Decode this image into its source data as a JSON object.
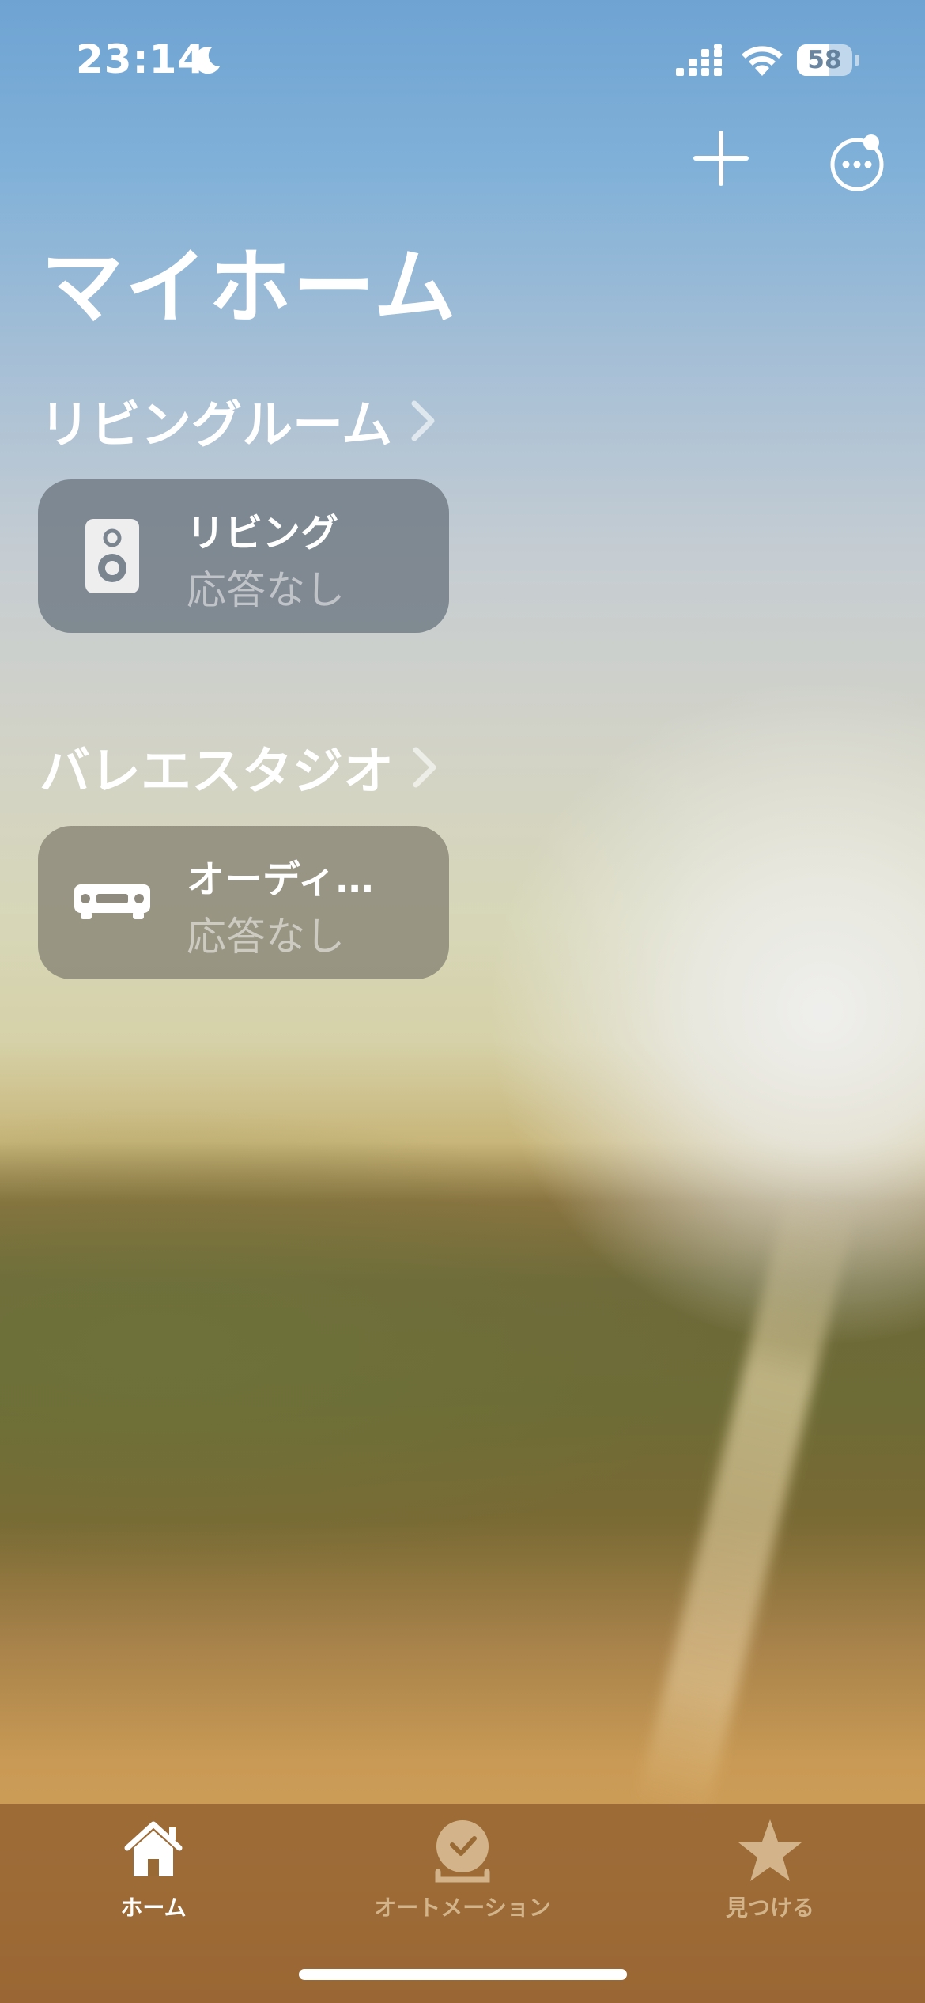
{
  "status_bar": {
    "time": "23:14",
    "battery_level": "58",
    "battery_fraction": 0.58
  },
  "page": {
    "title": "マイホーム"
  },
  "rooms": [
    {
      "name": "リビングルーム",
      "accessory": {
        "name": "リビング",
        "status": "応答なし",
        "icon": "speaker-icon"
      }
    },
    {
      "name": "バレエスタジオ",
      "accessory": {
        "name": "オーディ…",
        "status": "応答なし",
        "icon": "av-receiver-icon"
      }
    }
  ],
  "tab_bar": {
    "tabs": [
      {
        "label": "ホーム",
        "icon": "home-icon",
        "active": true
      },
      {
        "label": "オートメーション",
        "icon": "automation-clock-icon",
        "active": false
      },
      {
        "label": "見つける",
        "icon": "star-icon",
        "active": false
      }
    ]
  },
  "colors": {
    "tab_active": "#ffffff",
    "tab_inactive": "#d3b48a",
    "tile_room1": "#7b8590",
    "tile_room2": "#8f8b7f"
  }
}
